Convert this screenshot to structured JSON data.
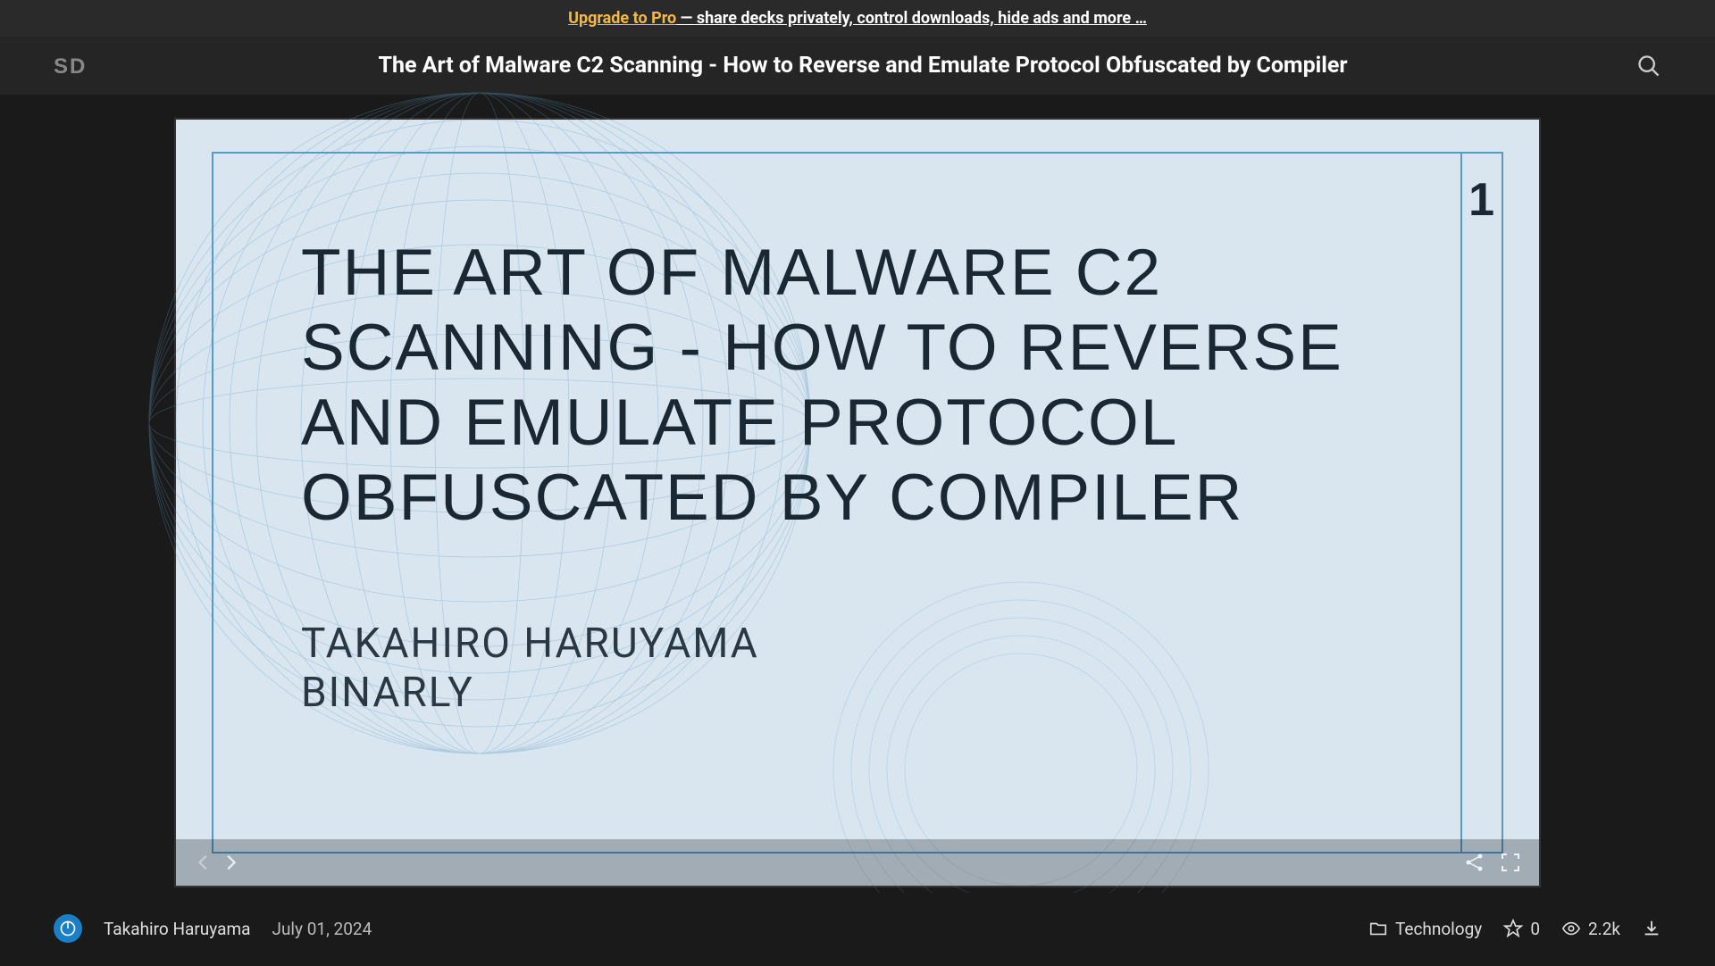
{
  "promo": {
    "link_text": "Upgrade to Pro",
    "rest_text": " — share decks privately, control downloads, hide ads and more …"
  },
  "header": {
    "title": "The Art of Malware C2 Scanning - How to Reverse and Emulate Protocol Obfuscated by Compiler"
  },
  "slide": {
    "number": "1",
    "title": "THE ART OF MALWARE C2 SCANNING - HOW TO REVERSE AND EMULATE PROTOCOL OBFUSCATED BY COMPILER",
    "author_line1": "TAKAHIRO HARUYAMA",
    "author_line2": "BINARLY"
  },
  "footer": {
    "author": "Takahiro Haruyama",
    "date": "July 01, 2024",
    "category": "Technology",
    "stars": "0",
    "views": "2.2k"
  }
}
